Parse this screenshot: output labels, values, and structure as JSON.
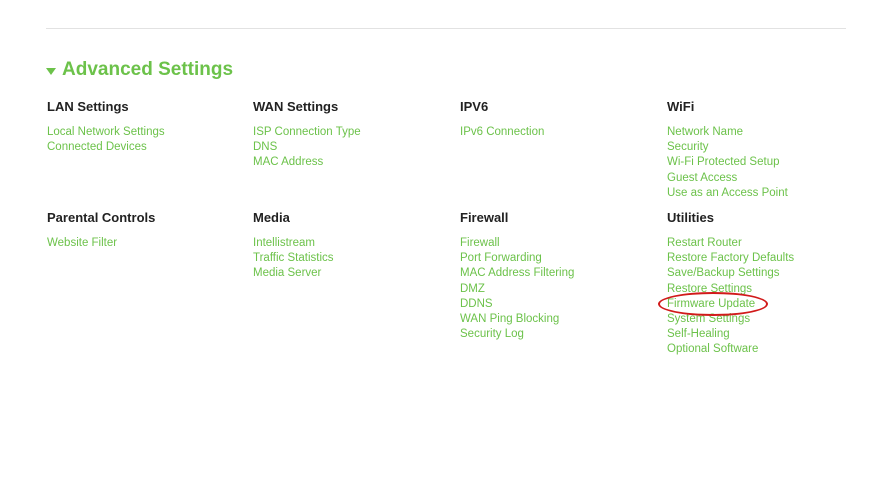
{
  "section": {
    "title": "Advanced Settings"
  },
  "groups": {
    "lan": {
      "title": "LAN Settings",
      "links": [
        "Local Network Settings",
        "Connected Devices"
      ]
    },
    "wan": {
      "title": "WAN Settings",
      "links": [
        "ISP Connection Type",
        "DNS",
        "MAC Address"
      ]
    },
    "ipv6": {
      "title": "IPV6",
      "links": [
        "IPv6 Connection"
      ]
    },
    "wifi": {
      "title": "WiFi",
      "links": [
        "Network Name",
        "Security",
        "Wi-Fi Protected Setup",
        "Guest Access",
        "Use as an Access Point"
      ]
    },
    "parental": {
      "title": "Parental Controls",
      "links": [
        "Website Filter"
      ]
    },
    "media": {
      "title": "Media",
      "links": [
        "Intellistream",
        "Traffic Statistics",
        "Media Server"
      ]
    },
    "firewall": {
      "title": "Firewall",
      "links": [
        "Firewall",
        "Port Forwarding",
        "MAC Address Filtering",
        "DMZ",
        "DDNS",
        "WAN Ping Blocking",
        "Security Log"
      ]
    },
    "utilities": {
      "title": "Utilities",
      "links": [
        "Restart Router",
        "Restore Factory Defaults",
        "Save/Backup Settings",
        "Restore Settings",
        "Firmware Update",
        "System Settings",
        "Self-Healing",
        "Optional Software"
      ]
    }
  },
  "colors": {
    "accent": "#6cc24a",
    "heading": "#222222",
    "annotation": "#d11a1a"
  },
  "icons": {
    "section_toggle": "caret-down-icon"
  }
}
